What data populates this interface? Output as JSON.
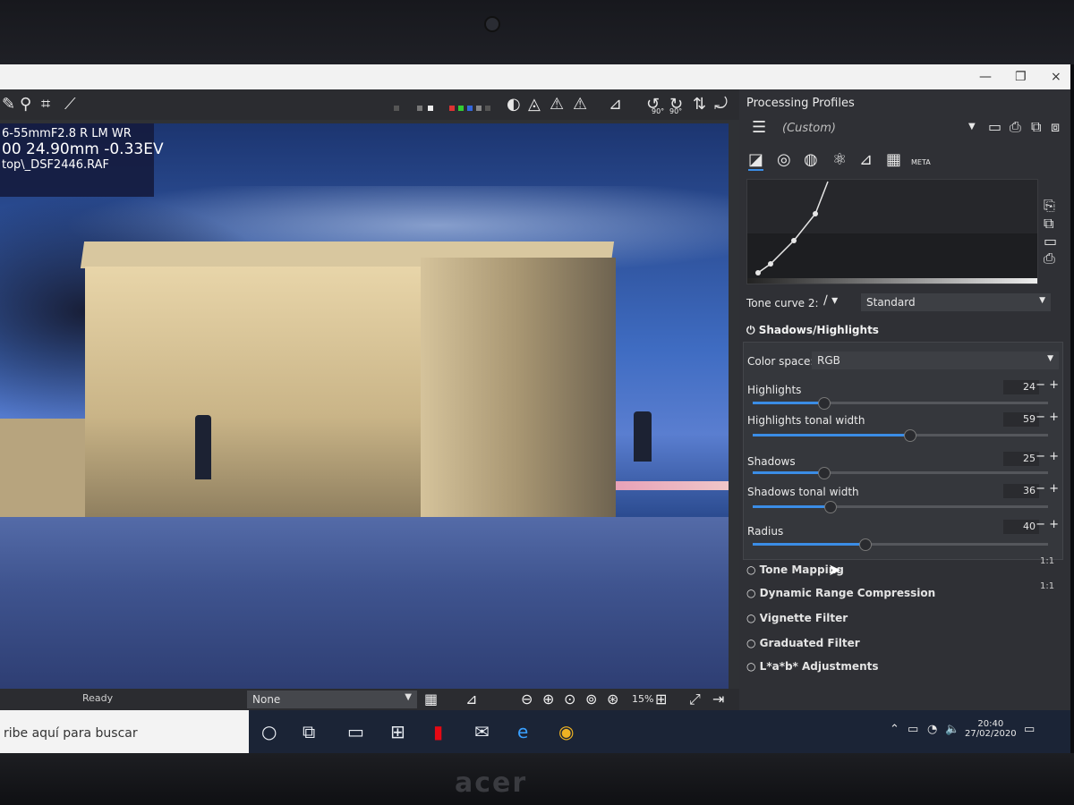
{
  "colors": {
    "accent": "#3b8de6",
    "panel": "#2f3035",
    "toolbar": "#2b2c30"
  },
  "window": {
    "minimize": "—",
    "maximize": "❐",
    "close": "×"
  },
  "exif": {
    "lens": "6-55mmF2.8 R LM WR",
    "exposure": "00  24.90mm  -0.33EV",
    "file": "top\\_DSF2446.RAF"
  },
  "toolbar": {
    "icons": [
      "pencil-icon",
      "eyedropper-icon",
      "crop-icon",
      "straighten-icon",
      "gamut-icon",
      "clip-highlights-icon",
      "warning-icon",
      "warning-icon",
      "perspective-icon",
      "rotate-left-icon",
      "rotate-right-icon",
      "flip-vertical-icon",
      "flip-horizontal-icon"
    ],
    "rot_left": "90°",
    "rot_right": "90°"
  },
  "panel": {
    "title": "Processing Profiles",
    "profile_value": "(Custom)",
    "tabs": [
      "exposure-tab",
      "detail-tab",
      "color-tab",
      "advanced-tab",
      "transform-tab",
      "raw-tab",
      "meta-tab"
    ],
    "meta_label": "META",
    "tone_curve": {
      "label": "Tone curve 2:",
      "mode": "Standard"
    }
  },
  "shadows_highlights": {
    "title": "Shadows/Highlights",
    "color_space_label": "Color space:",
    "color_space_value": "RGB",
    "sliders": [
      {
        "label": "Highlights",
        "value": "24",
        "fraction": 0.24
      },
      {
        "label": "Highlights tonal width",
        "value": "59",
        "fraction": 0.53
      },
      {
        "label": "Shadows",
        "value": "25",
        "fraction": 0.24
      },
      {
        "label": "Shadows tonal width",
        "value": "36",
        "fraction": 0.26
      },
      {
        "label": "Radius",
        "value": "40",
        "fraction": 0.38
      }
    ]
  },
  "collapsed_sections": [
    {
      "label": "Tone Mapping",
      "badge": "1:1"
    },
    {
      "label": "Dynamic Range Compression",
      "badge": "1:1"
    },
    {
      "label": "Vignette Filter",
      "badge": ""
    },
    {
      "label": "Graduated Filter",
      "badge": ""
    },
    {
      "label": "L*a*b* Adjustments",
      "badge": ""
    }
  ],
  "status": {
    "text": "Ready",
    "select": "None",
    "zoom": "15%"
  },
  "taskbar": {
    "search": "ribe aquí para buscar",
    "time": "20:40",
    "date": "27/02/2020"
  }
}
